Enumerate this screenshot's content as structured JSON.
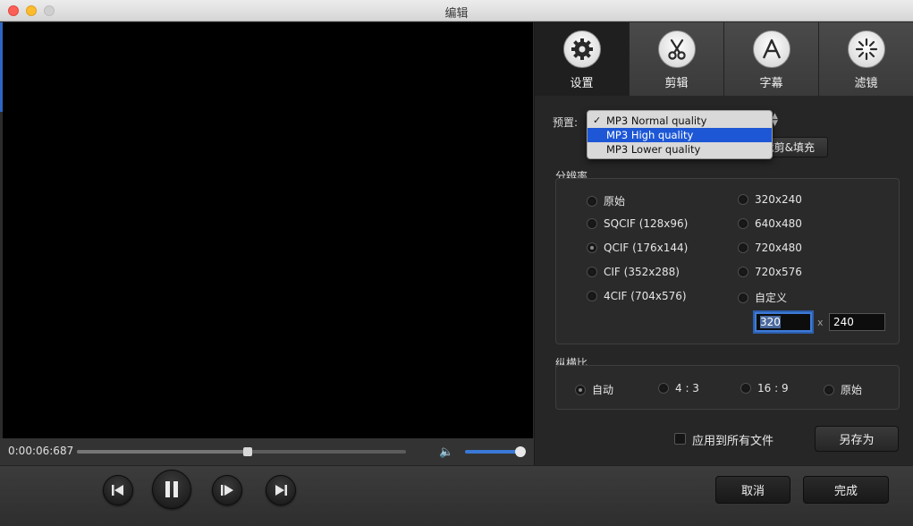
{
  "window": {
    "title": "编辑"
  },
  "player": {
    "time": "0:00:06:687",
    "seek_fraction": 0.52,
    "volume_fraction": 0.97
  },
  "tabs": [
    {
      "label": "设置",
      "icon": "gear-icon",
      "active": true
    },
    {
      "label": "剪辑",
      "icon": "scissors-icon",
      "active": false
    },
    {
      "label": "字幕",
      "icon": "letter-a-icon",
      "active": false
    },
    {
      "label": "滤镜",
      "icon": "sparkle-icon",
      "active": false
    }
  ],
  "preset": {
    "label": "预置:",
    "options": [
      "MP3 Normal quality",
      "MP3 High quality",
      "MP3 Lower quality"
    ],
    "checked": "MP3 Normal quality",
    "highlighted": "MP3 High quality",
    "check_mark": "✓"
  },
  "crop_button": "裁剪&填充",
  "resolution": {
    "title": "分辨率",
    "left_options": [
      "原始",
      "SQCIF (128x96)",
      "QCIF (176x144)",
      "CIF (352x288)",
      "4CIF (704x576)"
    ],
    "right_options": [
      "320x240",
      "640x480",
      "720x480",
      "720x576",
      "自定义"
    ],
    "selected": "QCIF (176x144)",
    "width_value": "320",
    "height_value": "240",
    "separator": "x"
  },
  "aspect": {
    "title": "纵横比",
    "options": [
      "自动",
      "4 : 3",
      "16 : 9",
      "原始"
    ],
    "selected": "自动"
  },
  "apply_all_label": "应用到所有文件",
  "save_as_label": "另存为",
  "cancel_label": "取消",
  "done_label": "完成",
  "colors": {
    "accent": "#1d57d6",
    "focus": "#3d7bd8"
  }
}
